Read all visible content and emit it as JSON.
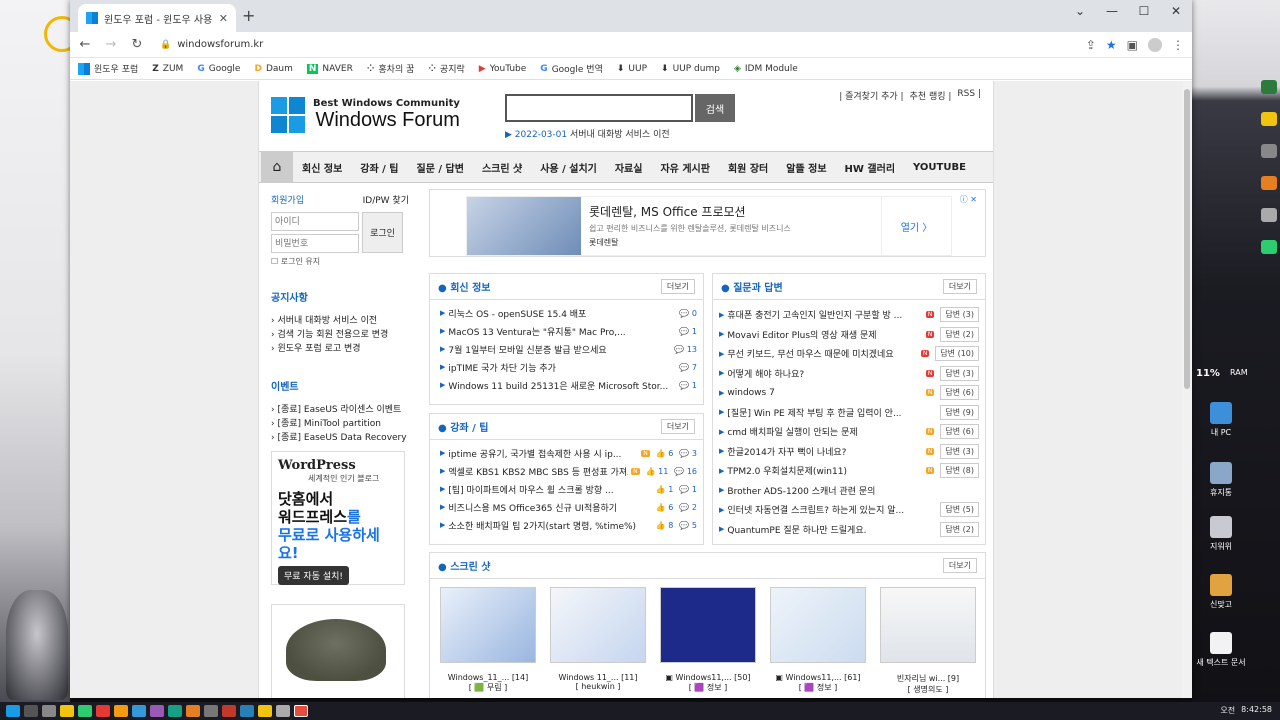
{
  "tab": {
    "title": "윈도우 포럼 - 윈도우 사용자 모",
    "close": "✕",
    "new_tab": "+"
  },
  "window_controls": {
    "min": "—",
    "max": "☐",
    "close": "✕",
    "chev": "⌄"
  },
  "address": {
    "url": "windowsforum.kr"
  },
  "bookmarks": [
    {
      "label": "윈도우 포럼",
      "glyph": "▦"
    },
    {
      "label": "ZUM",
      "glyph": "Z"
    },
    {
      "label": "Google",
      "glyph": "G"
    },
    {
      "label": "Daum",
      "glyph": "D"
    },
    {
      "label": "NAVER",
      "glyph": "N"
    },
    {
      "label": "홍차의 꿈",
      "glyph": "⁘"
    },
    {
      "label": "공지락",
      "glyph": "⁘"
    },
    {
      "label": "YouTube",
      "glyph": "▶"
    },
    {
      "label": "Google 번역",
      "glyph": "G"
    },
    {
      "label": "UUP",
      "glyph": "⬇"
    },
    {
      "label": "UUP dump",
      "glyph": "⬇"
    },
    {
      "label": "IDM Module",
      "glyph": "◈"
    }
  ],
  "header": {
    "logo_small": "Best Windows Community",
    "logo_big": "Windows Forum",
    "search_button": "검색",
    "notice_date": "2022-03-01",
    "notice_text": " 서버내 대화방 서비스 이전",
    "toplinks": [
      "| 즐겨찾기 추가 |",
      "추천 랭킹 |",
      "RSS |"
    ]
  },
  "nav": [
    "회신 정보",
    "강좌 / 팁",
    "질문 / 답변",
    "스크린 샷",
    "사용 / 설치기",
    "자료실",
    "자유 게시판",
    "회원 장터",
    "알뜰 정보",
    "HW 갤러리",
    "YOUTUBE"
  ],
  "login": {
    "join": "회원가입",
    "find": "ID/PW 찾기",
    "id_placeholder": "아이디",
    "pw_placeholder": "비밀번호",
    "button": "로그인",
    "keep": "로그인 유지"
  },
  "notices": {
    "title": "공지사항",
    "items": [
      "서버내 대화방 서비스 이전",
      "검색 기능 회원 전용으로 변경",
      "윈도우 포럼 로고 변경"
    ]
  },
  "events": {
    "title": "이벤트",
    "items": [
      "[종료] EaseUS 라이센스 이벤트",
      "[종료] MiniTool partition",
      "[종료] EaseUS Data Recovery"
    ]
  },
  "wp_ad": {
    "logo": "WordPress",
    "sub": "세계적인 인기 블로그",
    "line1": "닷홈에서",
    "line2a": "워드프레스",
    "line2b": "를",
    "line3": "무료로 사용하세요!",
    "button": "무료 자동 설치!"
  },
  "banner": {
    "title": "롯데렌탈, MS Office 프로모션",
    "desc": "쉽고 편리한 비즈니스를 위한 렌탈솔루션, 롯데렌탈 비즈니스",
    "brand": "롯데렌탈",
    "open": "열기 〉",
    "adx": "ⓘ ✕"
  },
  "more_label": "더보기",
  "latest": {
    "title": "회신 정보",
    "items": [
      {
        "text": "리눅스 OS - openSUSE 15.4 배포",
        "count": "0"
      },
      {
        "text": "MacOS 13 Ventura는 \"유지통\" Mac Pro,...",
        "count": "1"
      },
      {
        "text": "7월 1일부터 모바일 신분증 발급 받으세요",
        "count": "13"
      },
      {
        "text": "ipTIME 국가 차단 기능 추가",
        "count": "7"
      },
      {
        "text": "Windows 11 build 25131은 새로운 Microsoft Stor...",
        "count": "1"
      }
    ]
  },
  "tips": {
    "title": "강좌 / 팁",
    "items": [
      {
        "text": "iptime 공유기, 국가별 접속제한 사용 시 ip...",
        "like": "6",
        "count": "3"
      },
      {
        "text": "엑셀로 KBS1 KBS2 MBC SBS 등 편성표 가져오기",
        "like": "11",
        "count": "16"
      },
      {
        "text": "[팁] 마이파트에서 마우스 휠 스크롤 방향 ...",
        "like": "1",
        "count": "1"
      },
      {
        "text": "비즈니스용 MS Office365 신규 UI적용하기",
        "like": "6",
        "count": "2"
      },
      {
        "text": "소소한 배치파일 팁 2가지(start 명령, %time%)",
        "like": "8",
        "count": "5"
      }
    ]
  },
  "qna": {
    "title": "질문과 답변",
    "items": [
      {
        "text": "휴대폰 충전기 고속인지 일반인지 구분할 방 ...",
        "ans": "답변 (3)"
      },
      {
        "text": "Movavi Editor Plus의 영상 재생 문제",
        "ans": "답변 (2)"
      },
      {
        "text": "무선 키보드, 무선 마우스 때문에 미치겠네요",
        "ans": "답변 (10)"
      },
      {
        "text": "어떻게 해야 하나요?",
        "ans": "답변 (3)"
      },
      {
        "text": "windows 7",
        "ans": "답변 (6)"
      },
      {
        "text": "[질문] Win PE 제작 부팅 후 한글 입력이 안...",
        "ans": "답변 (9)"
      },
      {
        "text": "cmd 배치파일 실행이 안되는 문제",
        "ans": "답변 (6)"
      },
      {
        "text": "한글2014가 자꾸 뻑이 나네요?",
        "ans": "답변 (3)"
      },
      {
        "text": "TPM2.0 우회설치문제(win11)",
        "ans": "답변 (8)"
      },
      {
        "text": "Brother ADS-1200 스캐너 관련 문의",
        "ans": ""
      },
      {
        "text": "인터넷 자동연결 스크립트? 하는게 있는지 알...",
        "ans": "답변 (5)"
      },
      {
        "text": "QuantumPE 질문 하나만 드릴게요.",
        "ans": "답변 (2)"
      }
    ]
  },
  "shots": {
    "title": "스크린 샷",
    "items": [
      {
        "cap": "Windows_11_... [14]",
        "auth": "[ 🟩 무림 ]"
      },
      {
        "cap": "Windows 11_... [11]",
        "auth": "[ heukwin ]"
      },
      {
        "cap": "▣ Windows11,... [50]",
        "auth": "[ 🟪 정보 ]"
      },
      {
        "cap": "▣ Windows11,... [61]",
        "auth": "[ 🟪 정보 ]"
      },
      {
        "cap": "빈자리님 wi... [9]",
        "auth": "[ 생명의도 ]"
      }
    ]
  },
  "desktop_icons": [
    {
      "label": "내 PC"
    },
    {
      "label": "휴지통"
    },
    {
      "label": "지워위"
    },
    {
      "label": "신맞고"
    },
    {
      "label": "새 텍스트 문서"
    }
  ],
  "sys": {
    "cpu": "11%",
    "ram": "RAM"
  },
  "clock": {
    "ampm": "오전",
    "time": "8:42:58"
  },
  "colors": {
    "accent": "#1565c0",
    "win_blue": "#1a9be6"
  }
}
